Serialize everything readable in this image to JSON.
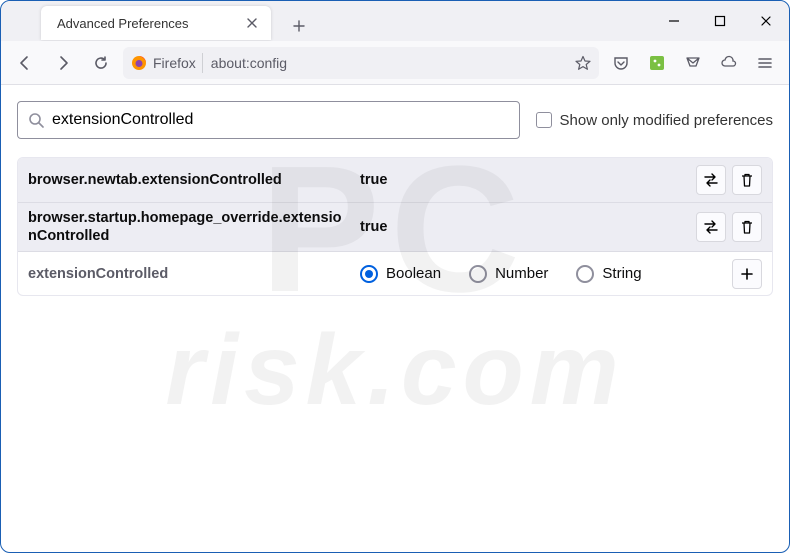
{
  "tab": {
    "title": "Advanced Preferences"
  },
  "urlbar": {
    "identity": "Firefox",
    "url": "about:config"
  },
  "search": {
    "value": "extensionControlled",
    "checkbox_label": "Show only modified preferences"
  },
  "prefs": [
    {
      "name": "browser.newtab.extensionControlled",
      "value": "true",
      "modified": true
    },
    {
      "name": "browser.startup.homepage_override.extensionControlled",
      "value": "true",
      "modified": true
    }
  ],
  "new_pref": {
    "name": "extensionControlled",
    "types": [
      "Boolean",
      "Number",
      "String"
    ],
    "selected": "Boolean"
  },
  "watermark": {
    "line1": "PC",
    "line2": "risk.com"
  }
}
